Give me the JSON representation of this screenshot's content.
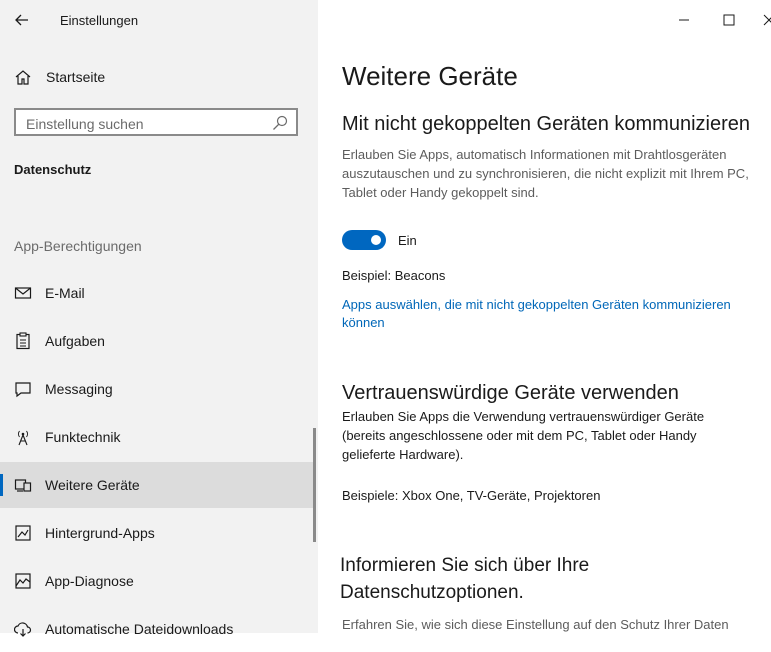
{
  "window": {
    "title": "Einstellungen"
  },
  "sidebar": {
    "home_label": "Startseite",
    "search_placeholder": "Einstellung suchen",
    "section_title": "Datenschutz",
    "group_title": "App-Berechtigungen",
    "items": [
      {
        "label": "E-Mail",
        "icon": "mail-icon"
      },
      {
        "label": "Aufgaben",
        "icon": "clipboard-icon"
      },
      {
        "label": "Messaging",
        "icon": "message-icon"
      },
      {
        "label": "Funktechnik",
        "icon": "radio-antenna-icon"
      },
      {
        "label": "Weitere Geräte",
        "icon": "devices-icon",
        "selected": true
      },
      {
        "label": "Hintergrund-Apps",
        "icon": "background-apps-icon"
      },
      {
        "label": "App-Diagnose",
        "icon": "diagnostics-icon"
      },
      {
        "label": "Automatische Dateidownloads",
        "icon": "cloud-download-icon"
      }
    ]
  },
  "main": {
    "page_title": "Weitere Geräte",
    "section1": {
      "heading": "Mit nicht gekoppelten Geräten kommunizieren",
      "description_lines": [
        "Erlauben Sie Apps, automatisch Informationen mit Drahtlosgeräten",
        "auszutauschen und zu synchronisieren, die nicht explizit mit Ihrem PC,",
        "Tablet oder Handy gekoppelt sind."
      ],
      "toggle_state": "on",
      "toggle_label": "Ein",
      "example": "Beispiel: Beacons",
      "link_lines": [
        "Apps auswählen, die mit nicht gekoppelten Geräten kommunizieren",
        "können"
      ]
    },
    "section2": {
      "heading": "Vertrauenswürdige Geräte verwenden",
      "description_lines": [
        "Erlauben Sie Apps die Verwendung vertrauenswürdiger Geräte",
        "(bereits angeschlossene oder mit dem PC, Tablet oder Handy",
        "gelieferte Hardware)."
      ],
      "example": "Beispiele: Xbox One, TV-Geräte, Projektoren"
    },
    "section3": {
      "heading_lines": [
        "Informieren Sie sich über Ihre",
        "Datenschutzoptionen."
      ],
      "description": "Erfahren Sie, wie sich diese Einstellung auf den Schutz Ihrer Daten"
    }
  },
  "colors": {
    "accent": "#0067c0",
    "link": "#0067b8",
    "sidebar_bg": "#f2f2f2",
    "selected_bg": "#dcdcdc"
  }
}
